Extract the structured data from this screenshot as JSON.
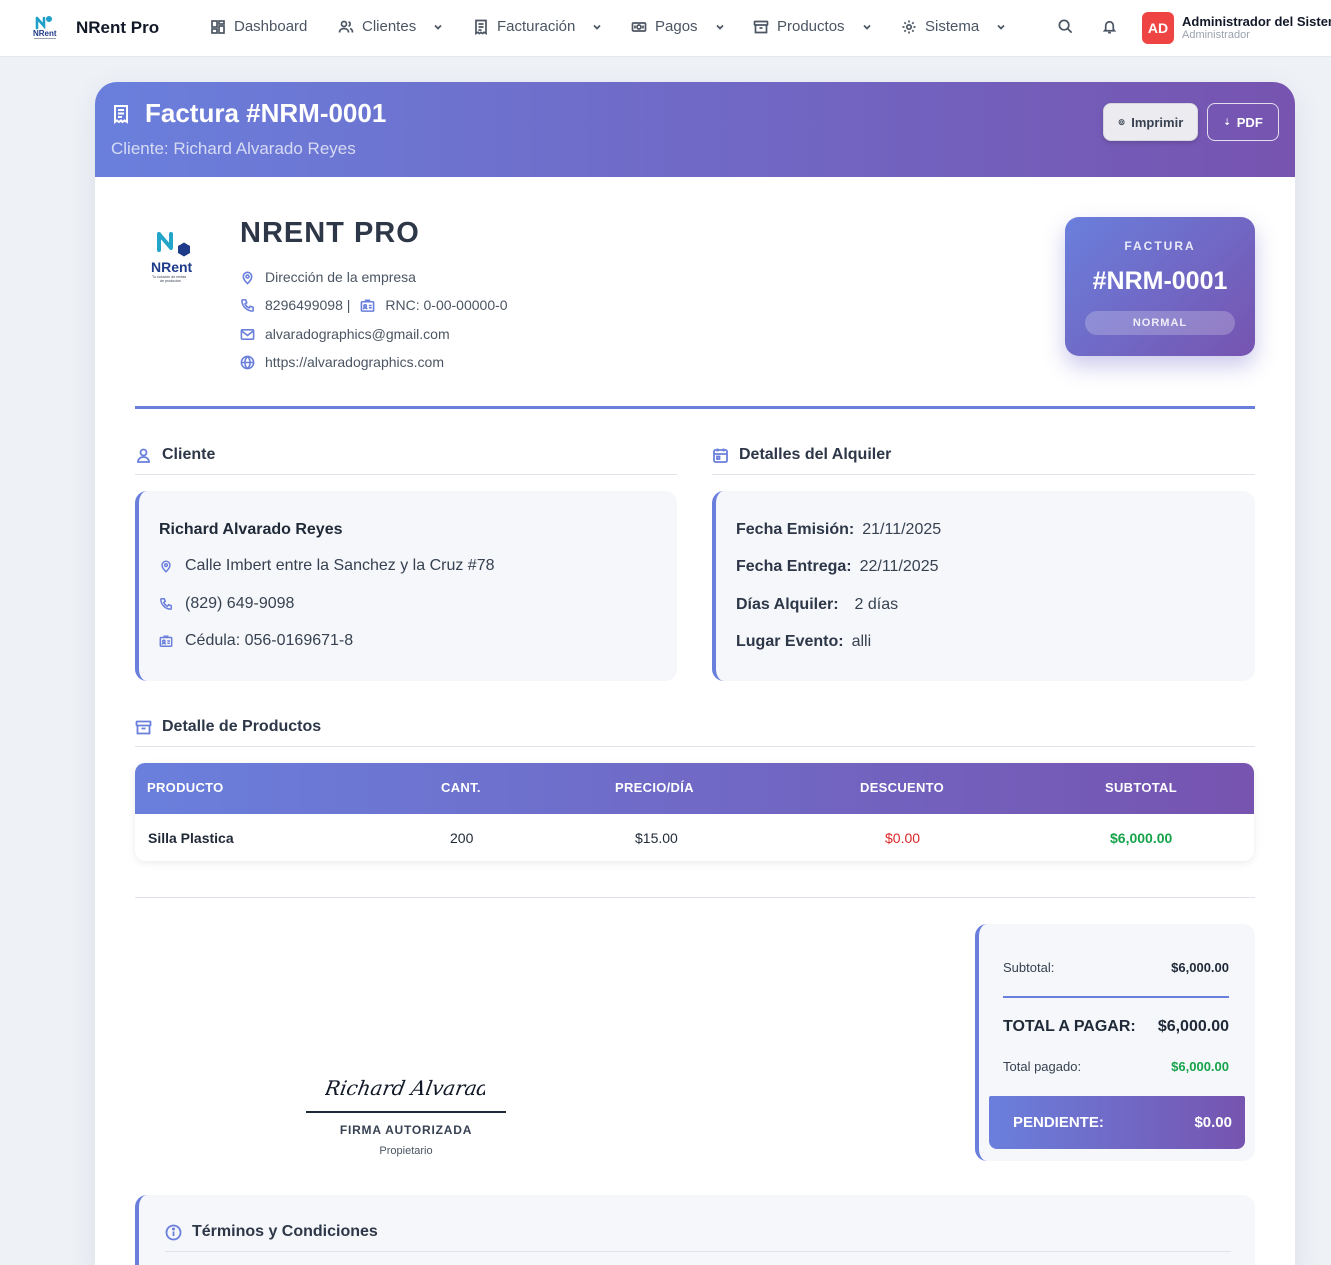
{
  "nav": {
    "brand": "NRent Pro",
    "menu": [
      {
        "label": "Dashboard",
        "icon": "dashboard-icon",
        "dropdown": false
      },
      {
        "label": "Clientes",
        "icon": "users-icon",
        "dropdown": true
      },
      {
        "label": "Facturación",
        "icon": "receipt-icon",
        "dropdown": true
      },
      {
        "label": "Pagos",
        "icon": "money-icon",
        "dropdown": true
      },
      {
        "label": "Productos",
        "icon": "box-icon",
        "dropdown": true
      },
      {
        "label": "Sistema",
        "icon": "gear-icon",
        "dropdown": true
      }
    ],
    "user": {
      "initials": "AD",
      "name": "Administrador del Sistema",
      "role": "Administrador"
    }
  },
  "header": {
    "title": "Factura #NRM-0001",
    "subtitle": "Cliente: Richard Alvarado Reyes",
    "print_label": "Imprimir",
    "pdf_label": "PDF"
  },
  "company": {
    "logo_text": "NRent",
    "logo_tagline": "Tu solución de rentas de productos",
    "name": "NRENT PRO",
    "address": "Dirección de la empresa",
    "phone": "8296499098 |",
    "rnc": "RNC: 0-00-00000-0",
    "email": "alvaradographics@gmail.com",
    "website": "https://alvaradographics.com"
  },
  "invoice_box": {
    "label": "FACTURA",
    "number": "#NRM-0001",
    "type": "NORMAL"
  },
  "client": {
    "section_title": "Cliente",
    "name": "Richard Alvarado Reyes",
    "address": "Calle Imbert entre la Sanchez y la Cruz #78",
    "phone": "(829) 649-9098",
    "id": "Cédula: 056-0169671-8"
  },
  "rental": {
    "section_title": "Detalles del Alquiler",
    "issue_label": "Fecha Emisión:",
    "issue_value": "21/11/2025",
    "delivery_label": "Fecha Entrega:",
    "delivery_value": "22/11/2025",
    "days_label": "Días Alquiler:",
    "days_value": "2 días",
    "place_label": "Lugar Evento:",
    "place_value": "alli"
  },
  "products": {
    "section_title": "Detalle de Productos",
    "headers": [
      "PRODUCTO",
      "CANT.",
      "PRECIO/DÍA",
      "DESCUENTO",
      "SUBTOTAL"
    ],
    "rows": [
      {
        "product": "Silla Plastica",
        "qty": "200",
        "price": "$15.00",
        "discount": "$0.00",
        "subtotal": "$6,000.00"
      }
    ]
  },
  "signature": {
    "script": "Richard Alvarado R.",
    "label": "FIRMA AUTORIZADA",
    "role": "Propietario"
  },
  "totals": {
    "subtotal_label": "Subtotal:",
    "subtotal_value": "$6,000.00",
    "total_label": "TOTAL A PAGAR:",
    "total_value": "$6,000.00",
    "paid_label": "Total pagado:",
    "paid_value": "$6,000.00",
    "pending_label": "PENDIENTE:",
    "pending_value": "$0.00"
  },
  "terms": {
    "title": "Términos y Condiciones"
  },
  "colors": {
    "accent": "#6a7fdc",
    "accent_dark": "#7654b0",
    "discount": "#dc2626",
    "positive": "#16a34a",
    "avatar": "#ef4444"
  }
}
